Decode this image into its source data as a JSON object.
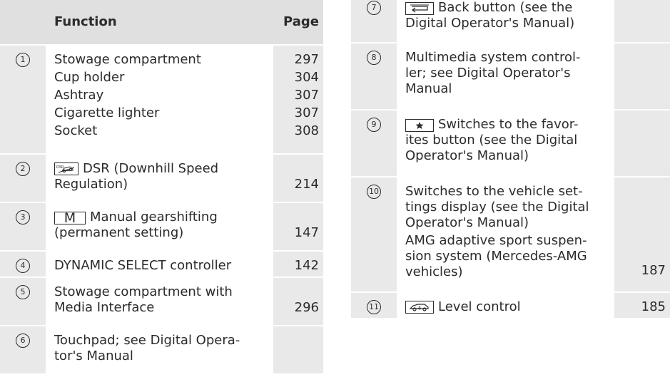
{
  "headers": {
    "function": "Function",
    "page": "Page"
  },
  "left": [
    {
      "num": "1",
      "items": [
        {
          "text": "Stowage compartment",
          "page": "297"
        },
        {
          "text": "Cup holder",
          "page": "304"
        },
        {
          "text": "Ashtray",
          "page": "307"
        },
        {
          "text": "Cigarette lighter",
          "page": "307"
        },
        {
          "text": "Socket",
          "page": "308"
        }
      ]
    },
    {
      "num": "2",
      "icon": "dsr-icon",
      "line1": "DSR (Downhill Speed",
      "line2": "Regulation)",
      "page": "214"
    },
    {
      "num": "3",
      "icon": "m-button",
      "icon_label": "M",
      "line1": "Manual gearshifting",
      "line2": "(permanent setting)",
      "page": "147"
    },
    {
      "num": "4",
      "text": "DYNAMIC SELECT controller",
      "page": "142"
    },
    {
      "num": "5",
      "line1": "Stowage compartment with",
      "line2": "Media Interface",
      "page": "296"
    },
    {
      "num": "6",
      "line1": "Touchpad; see Digital Opera-",
      "line2": "tor's Manual",
      "page": ""
    }
  ],
  "right": [
    {
      "num": "7",
      "icon": "back-button-icon",
      "line1": "Back button (see the",
      "line2": "Digital Operator's Manual)",
      "page": ""
    },
    {
      "num": "8",
      "line1": "Multimedia system control-",
      "line2": "ler; see Digital Operator's",
      "line3": "Manual",
      "page": ""
    },
    {
      "num": "9",
      "icon": "favorites-star-icon",
      "line1": "Switches to the favor-",
      "line2": "ites button (see the Digital",
      "line3": "Operator's Manual)",
      "page": ""
    },
    {
      "num": "10",
      "line1": "Switches to the vehicle set-",
      "line2": "tings display (see the Digital",
      "line3": "Operator's Manual)",
      "line4": "AMG adaptive sport suspen-",
      "line5": "sion system (Mercedes-AMG",
      "line6": "vehicles)",
      "page": "187"
    },
    {
      "num": "11",
      "icon": "level-control-icon",
      "text": "Level control",
      "page": "185"
    }
  ],
  "colors": {
    "shade": "#e9e9e9",
    "header_shade": "#e0e0e0",
    "text": "#2b2b2b"
  }
}
